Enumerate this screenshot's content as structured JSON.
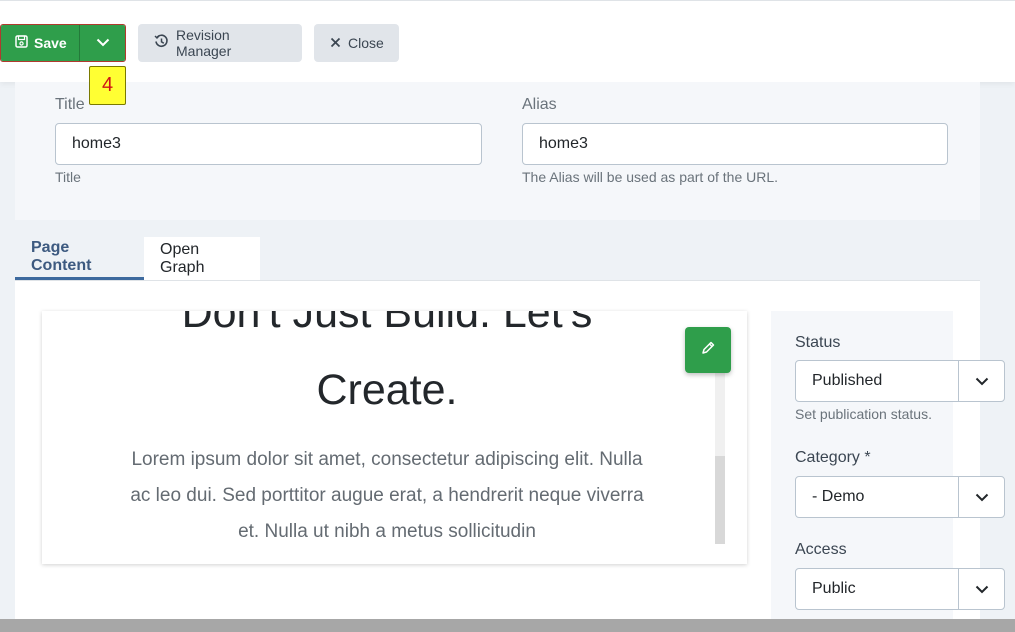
{
  "toolbar": {
    "save_label": "Save",
    "revision_label": "Revision Manager",
    "close_label": "Close",
    "badge": "4"
  },
  "fields": {
    "title_label": "Title",
    "title_value": "home3",
    "title_help": "Title",
    "alias_label": "Alias",
    "alias_value": "home3",
    "alias_help": "The Alias will be used as part of the URL."
  },
  "tabs": [
    {
      "label": "Page Content",
      "active": true
    },
    {
      "label": "Open Graph",
      "active": false
    }
  ],
  "editor": {
    "heading_line1": "Don't Just Build. Let's",
    "heading_line2": "Create.",
    "paragraph": "Lorem ipsum dolor sit amet, consectetur adipiscing elit. Nulla ac leo dui. Sed porttitor augue erat, a hendrerit neque viverra et. Nulla ut nibh a metus sollicitudin"
  },
  "sidebar": {
    "status_label": "Status",
    "status_value": "Published",
    "status_help": "Set publication status.",
    "category_label": "Category *",
    "category_value": "- Demo",
    "access_label": "Access",
    "access_value": "Public"
  },
  "colors": {
    "accent_green": "#2f9e4b",
    "tab_active": "#3d6a9e",
    "badge_bg": "#ffff33"
  }
}
